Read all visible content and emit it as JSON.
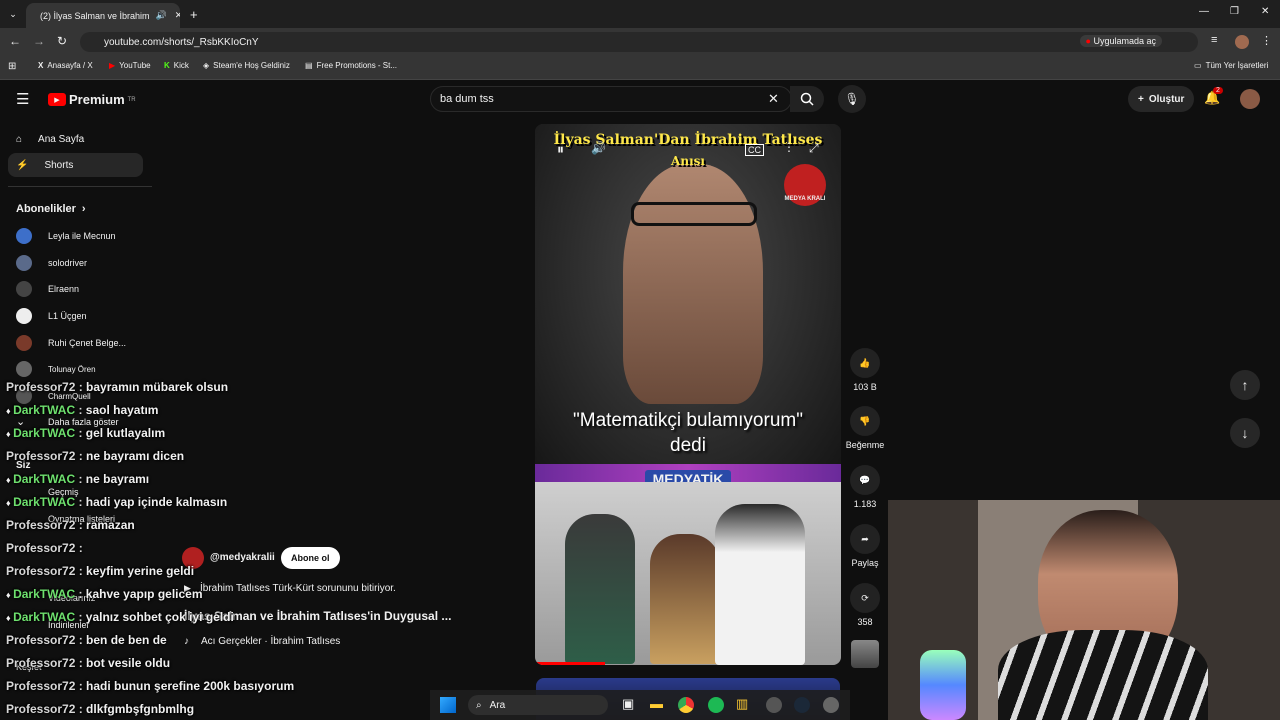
{
  "browser": {
    "tab_title": "(2) İlyas Salman ve İbrahim",
    "url": "youtube.com/shorts/_RsbKKIoCnY",
    "open_in_app": "Uygulamada aç",
    "bookmarks": [
      "Anasayfa / X",
      "YouTube",
      "Kick",
      "Steam'e Hoş Geldiniz",
      "Free Promotions - St..."
    ],
    "all_bookmarks": "Tüm Yer İşaretleri"
  },
  "header": {
    "brand": "Premium",
    "brand_sup": "TR",
    "search_value": "ba dum tss",
    "create": "Oluştur",
    "notif_count": "2"
  },
  "sidebar": {
    "home": "Ana Sayfa",
    "shorts": "Shorts",
    "subs_title": "Abonelikler",
    "subs": [
      {
        "name": "Leyla ile Mecnun",
        "color": "#3d6fc9"
      },
      {
        "name": "solodriver",
        "color": "#5a6a8a"
      },
      {
        "name": "Elraenn",
        "color": "#444"
      },
      {
        "name": "L1 Üçgen",
        "color": "#eee"
      },
      {
        "name": "Ruhi Çenet Belge...",
        "color": "#7a3a2a"
      },
      {
        "name": "Tolunay Ören",
        "color": "#666"
      },
      {
        "name": "CharmQuell",
        "color": "#555"
      }
    ],
    "more": "Daha fazla göster",
    "you": "Siz",
    "history": "Geçmiş",
    "playlists": "Oynatma listeleri",
    "videos": "Videolarınız",
    "watch_later": "Daha sonra izle",
    "liked": "Beğenilen videolar",
    "downloads": "İndirilenler",
    "explore": "Keşfet"
  },
  "short": {
    "title_top": "İlyas Salman'Dan İbrahim Tatlıses",
    "subtitle_top": "Anısı",
    "logo": "MEDYA KRALI",
    "quote": "\"Matematikçi bulamıyorum\" dedi",
    "brand": "MEDYATİK",
    "channel": "@medyakralii",
    "subscribe": "Abone ol",
    "desc": "İbrahim Tatlıses Türk-Kürt sorununu bitiriyor.",
    "related": "İlyas Salman ve İbrahim Tatlıses'in Duygusal ...",
    "music": "Acı Gerçekler · İbrahim Tatlıses"
  },
  "actions": {
    "likes": "103 B",
    "dislike": "Beğenme",
    "comments": "1.183",
    "share": "Paylaş",
    "remix": "358"
  },
  "chat": [
    {
      "user": "Professor72",
      "msg": "bayramın mübarek olsun",
      "u": "u1"
    },
    {
      "user": "DarkTWAC",
      "msg": "saol hayatım",
      "u": "u2"
    },
    {
      "user": "DarkTWAC",
      "msg": "gel kutlayalım",
      "u": "u2"
    },
    {
      "user": "Professor72",
      "msg": "ne bayramı dicen",
      "u": "u1"
    },
    {
      "user": "DarkTWAC",
      "msg": "ne bayramı",
      "u": "u2"
    },
    {
      "user": "DarkTWAC",
      "msg": "hadi yap içinde kalmasın",
      "u": "u2"
    },
    {
      "user": "Professor72",
      "msg": "ramazan",
      "u": "u1"
    },
    {
      "user": "Professor72",
      "msg": "",
      "u": "u1"
    },
    {
      "user": "Professor72",
      "msg": "keyfim yerine geldi",
      "u": "u1"
    },
    {
      "user": "DarkTWAC",
      "msg": "kahve yapıp gelicem",
      "u": "u2"
    },
    {
      "user": "DarkTWAC",
      "msg": "yalnız sohbet çok iyi geldi",
      "u": "u2"
    },
    {
      "user": "Professor72",
      "msg": "ben de ben de",
      "u": "u1"
    },
    {
      "user": "Professor72",
      "msg": "bot vesile oldu",
      "u": "u1"
    },
    {
      "user": "Professor72",
      "msg": "hadi bunun şerefine 200k basıyorum",
      "u": "u1"
    },
    {
      "user": "Professor72",
      "msg": "dlkfgmbşfgnbmlhg",
      "u": "u1"
    }
  ],
  "taskbar": {
    "search": "Ara"
  }
}
